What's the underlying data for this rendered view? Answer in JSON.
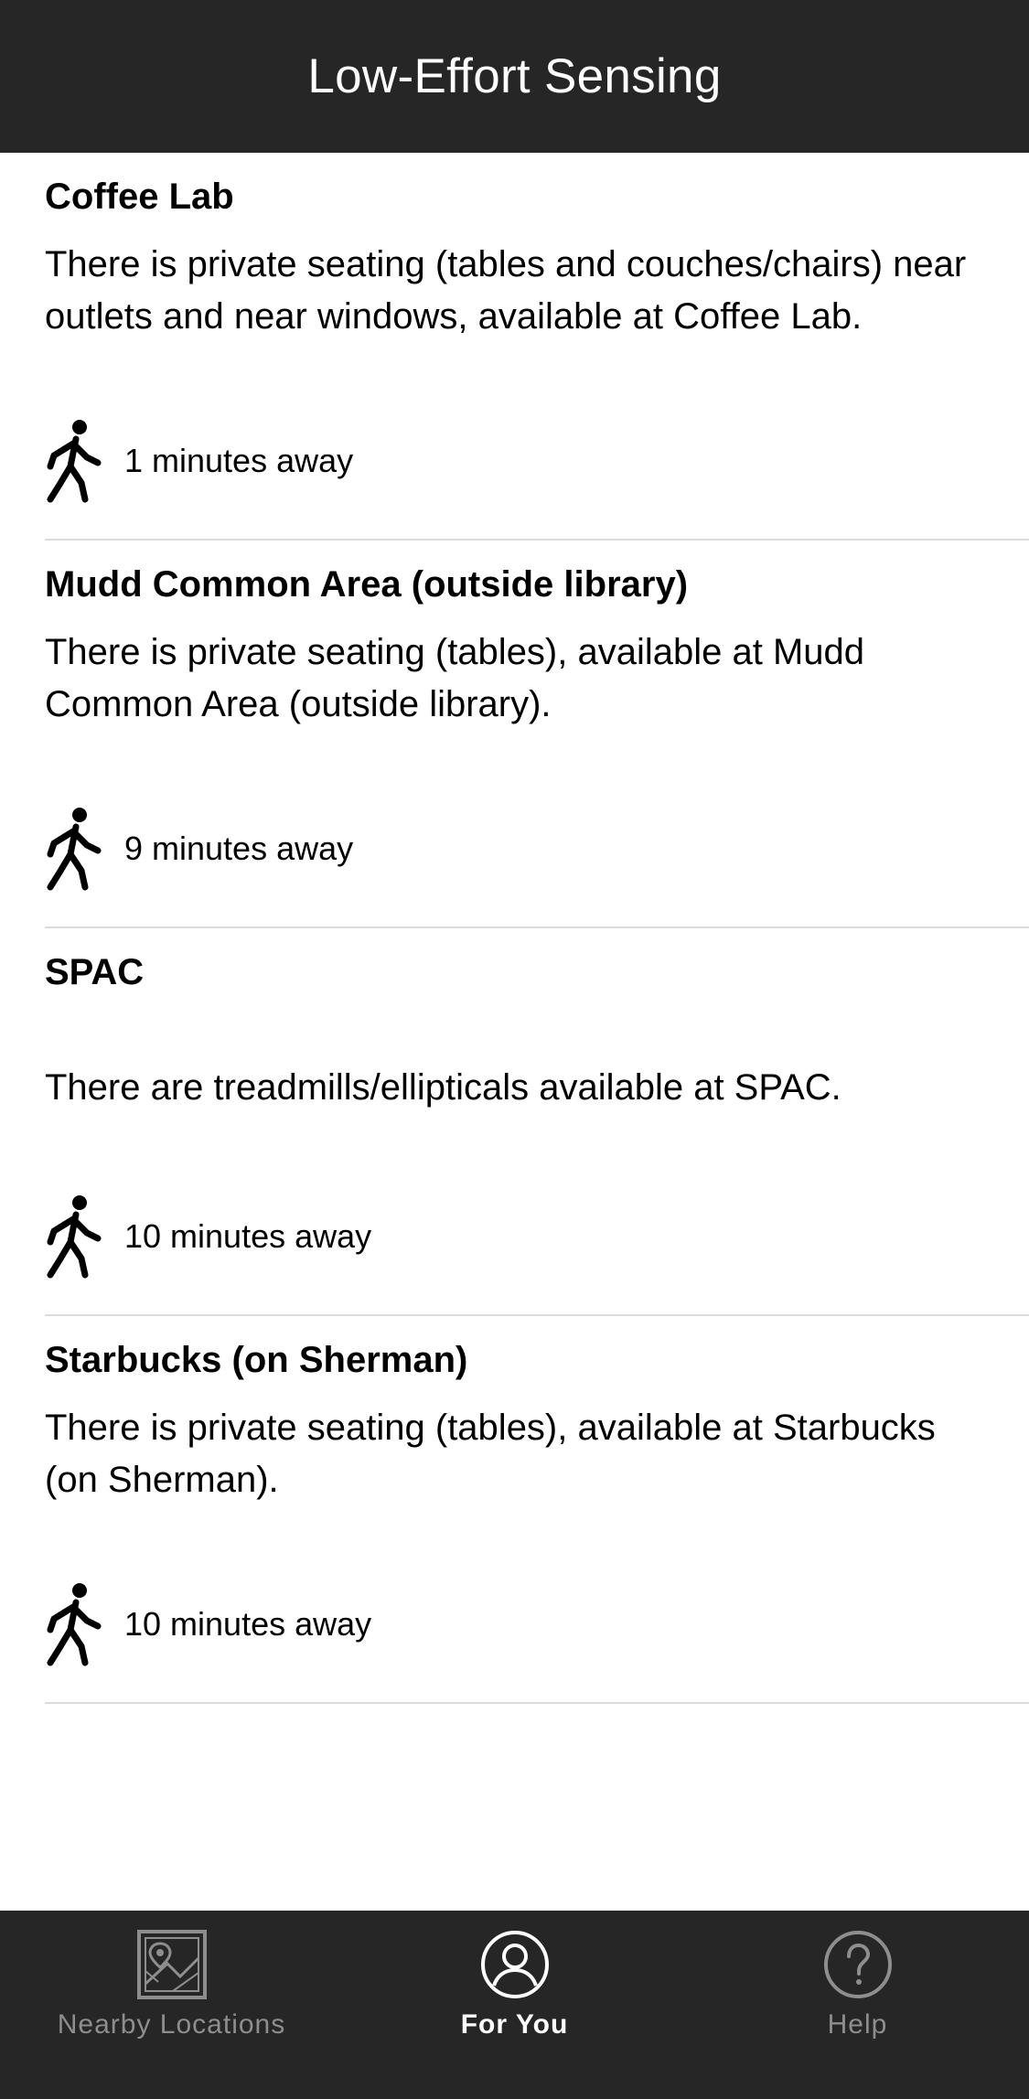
{
  "nav": {
    "title": "Low-Effort Sensing"
  },
  "cards": [
    {
      "title": "Coffee Lab",
      "description": "There is private seating (tables and couches/chairs) near outlets and near windows, available at Coffee Lab.",
      "distance": "1 minutes away",
      "icon": "walking-person-icon"
    },
    {
      "title": "Mudd Common Area (outside library)",
      "description": "There is private seating (tables), available at Mudd Common Area (outside library).",
      "distance": "9 minutes away",
      "icon": "walking-person-icon"
    },
    {
      "title": "SPAC",
      "description": "There are treadmills/ellipticals available at SPAC.",
      "distance": "10 minutes away",
      "icon": "walking-person-icon"
    },
    {
      "title": "Starbucks (on Sherman)",
      "description": "There is private seating (tables), available at Starbucks (on Sherman).",
      "distance": "10 minutes away",
      "icon": "walking-person-icon"
    }
  ],
  "tabs": [
    {
      "label": "Nearby Locations",
      "icon": "map-icon",
      "active": false
    },
    {
      "label": "For You",
      "icon": "user-circle-icon",
      "active": true
    },
    {
      "label": "Help",
      "icon": "question-circle-icon",
      "active": false
    }
  ],
  "colors": {
    "bar_background": "#262626",
    "active_tab": "#ffffff",
    "inactive_tab": "#8e8e8e",
    "divider": "#dcdcdc"
  }
}
